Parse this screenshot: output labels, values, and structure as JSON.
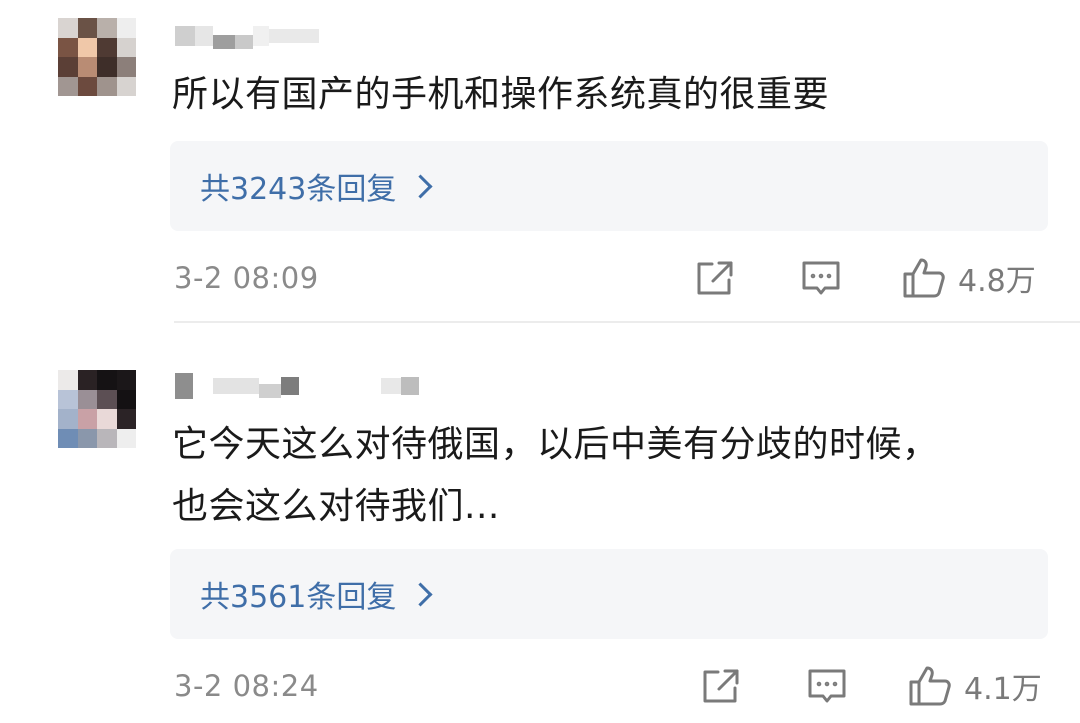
{
  "comments": [
    {
      "text": "所以有国产的手机和操作系统真的很重要",
      "replies_label": "共3243条回复",
      "time": "3-2 08:09",
      "likes": "4.8万"
    },
    {
      "text_line1": "它今天这么对待俄国，以后中美有分歧的时候，",
      "text_line2": "也会这么对待我们...",
      "replies_label": "共3561条回复",
      "time": "3-2 08:24",
      "likes": "4.1万"
    }
  ],
  "icons": {
    "share": "share-icon",
    "comment": "comment-icon",
    "like": "thumbs-up-icon",
    "chevron": "chevron-right-icon"
  },
  "colors": {
    "reply_link": "#3f6ea8",
    "reply_bg": "#f5f6f8",
    "meta_text": "#8a8a8a"
  }
}
